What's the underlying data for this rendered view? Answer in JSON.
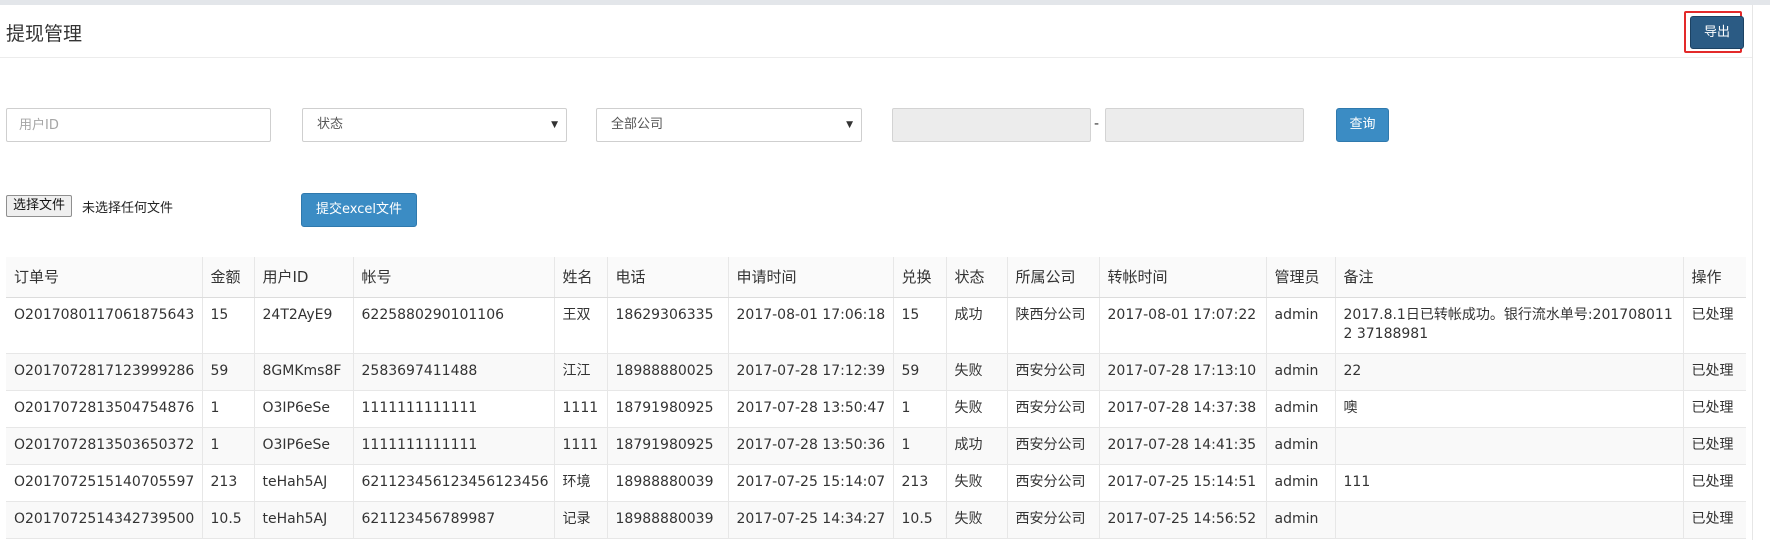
{
  "header": {
    "title": "提现管理",
    "export_label": "导出"
  },
  "filters": {
    "userid_placeholder": "用户ID",
    "status_selected": "状态",
    "company_selected": "全部公司",
    "date_separator": "-",
    "query_label": "查询"
  },
  "upload": {
    "choose_file_label": "选择文件",
    "file_status": "未选择任何文件",
    "submit_label": "提交excel文件"
  },
  "table": {
    "headers": [
      "订单号",
      "金额",
      "用户ID",
      "帐号",
      "姓名",
      "电话",
      "申请时间",
      "兑换",
      "状态",
      "所属公司",
      "转帐时间",
      "管理员",
      "备注",
      "操作"
    ],
    "rows": [
      [
        "O2017080117061875643",
        "15",
        "24T2AyE9",
        "6225880290101106",
        "王双",
        "18629306335",
        "2017-08-01 17:06:18",
        "15",
        "成功",
        "陕西分公司",
        "2017-08-01 17:07:22",
        "admin",
        "2017.8.1日已转帐成功。银行流水单号:2017080112 37188981",
        "已处理"
      ],
      [
        "O2017072817123999286",
        "59",
        "8GMKms8F",
        "2583697411488",
        "江江",
        "18988880025",
        "2017-07-28 17:12:39",
        "59",
        "失败",
        "西安分公司",
        "2017-07-28 17:13:10",
        "admin",
        "22",
        "已处理"
      ],
      [
        "O2017072813504754876",
        "1",
        "O3IP6eSe",
        "1111111111111",
        "1111",
        "18791980925",
        "2017-07-28 13:50:47",
        "1",
        "失败",
        "西安分公司",
        "2017-07-28 14:37:38",
        "admin",
        "噢",
        "已处理"
      ],
      [
        "O2017072813503650372",
        "1",
        "O3IP6eSe",
        "1111111111111",
        "1111",
        "18791980925",
        "2017-07-28 13:50:36",
        "1",
        "成功",
        "西安分公司",
        "2017-07-28 14:41:35",
        "admin",
        "",
        "已处理"
      ],
      [
        "O2017072515140705597",
        "213",
        "teHah5AJ",
        "621123456123456123456",
        "环境",
        "18988880039",
        "2017-07-25 15:14:07",
        "213",
        "失败",
        "西安分公司",
        "2017-07-25 15:14:51",
        "admin",
        "111",
        "已处理"
      ],
      [
        "O2017072514342739500",
        "10.5",
        "teHah5AJ",
        "621123456789987",
        "记录",
        "18988880039",
        "2017-07-25 14:34:27",
        "10.5",
        "失败",
        "西安分公司",
        "2017-07-25 14:56:52",
        "admin",
        "",
        "已处理"
      ]
    ]
  },
  "colors": {
    "primary": "#3b8cc4",
    "export": "#2b5b84",
    "highlight": "#e32a2a"
  }
}
